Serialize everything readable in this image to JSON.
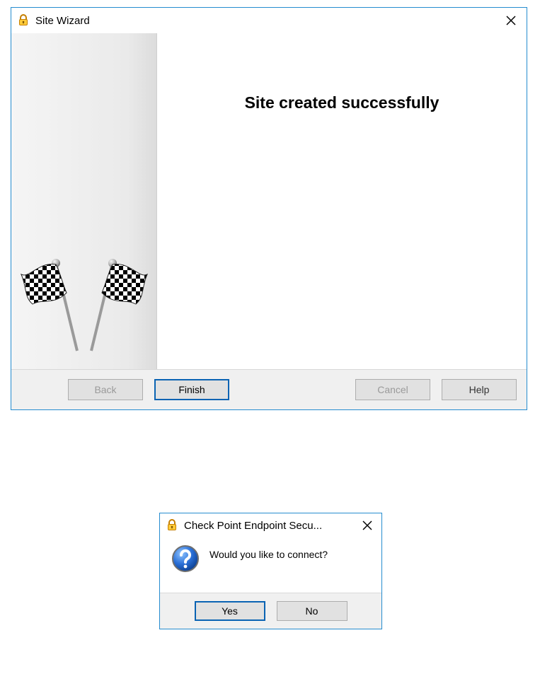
{
  "wizard": {
    "title": "Site Wizard",
    "heading": "Site created successfully",
    "buttons": {
      "back": "Back",
      "finish": "Finish",
      "cancel": "Cancel",
      "help": "Help"
    }
  },
  "dialog": {
    "title": "Check Point Endpoint Secu...",
    "message": "Would you like to connect?",
    "buttons": {
      "yes": "Yes",
      "no": "No"
    }
  }
}
